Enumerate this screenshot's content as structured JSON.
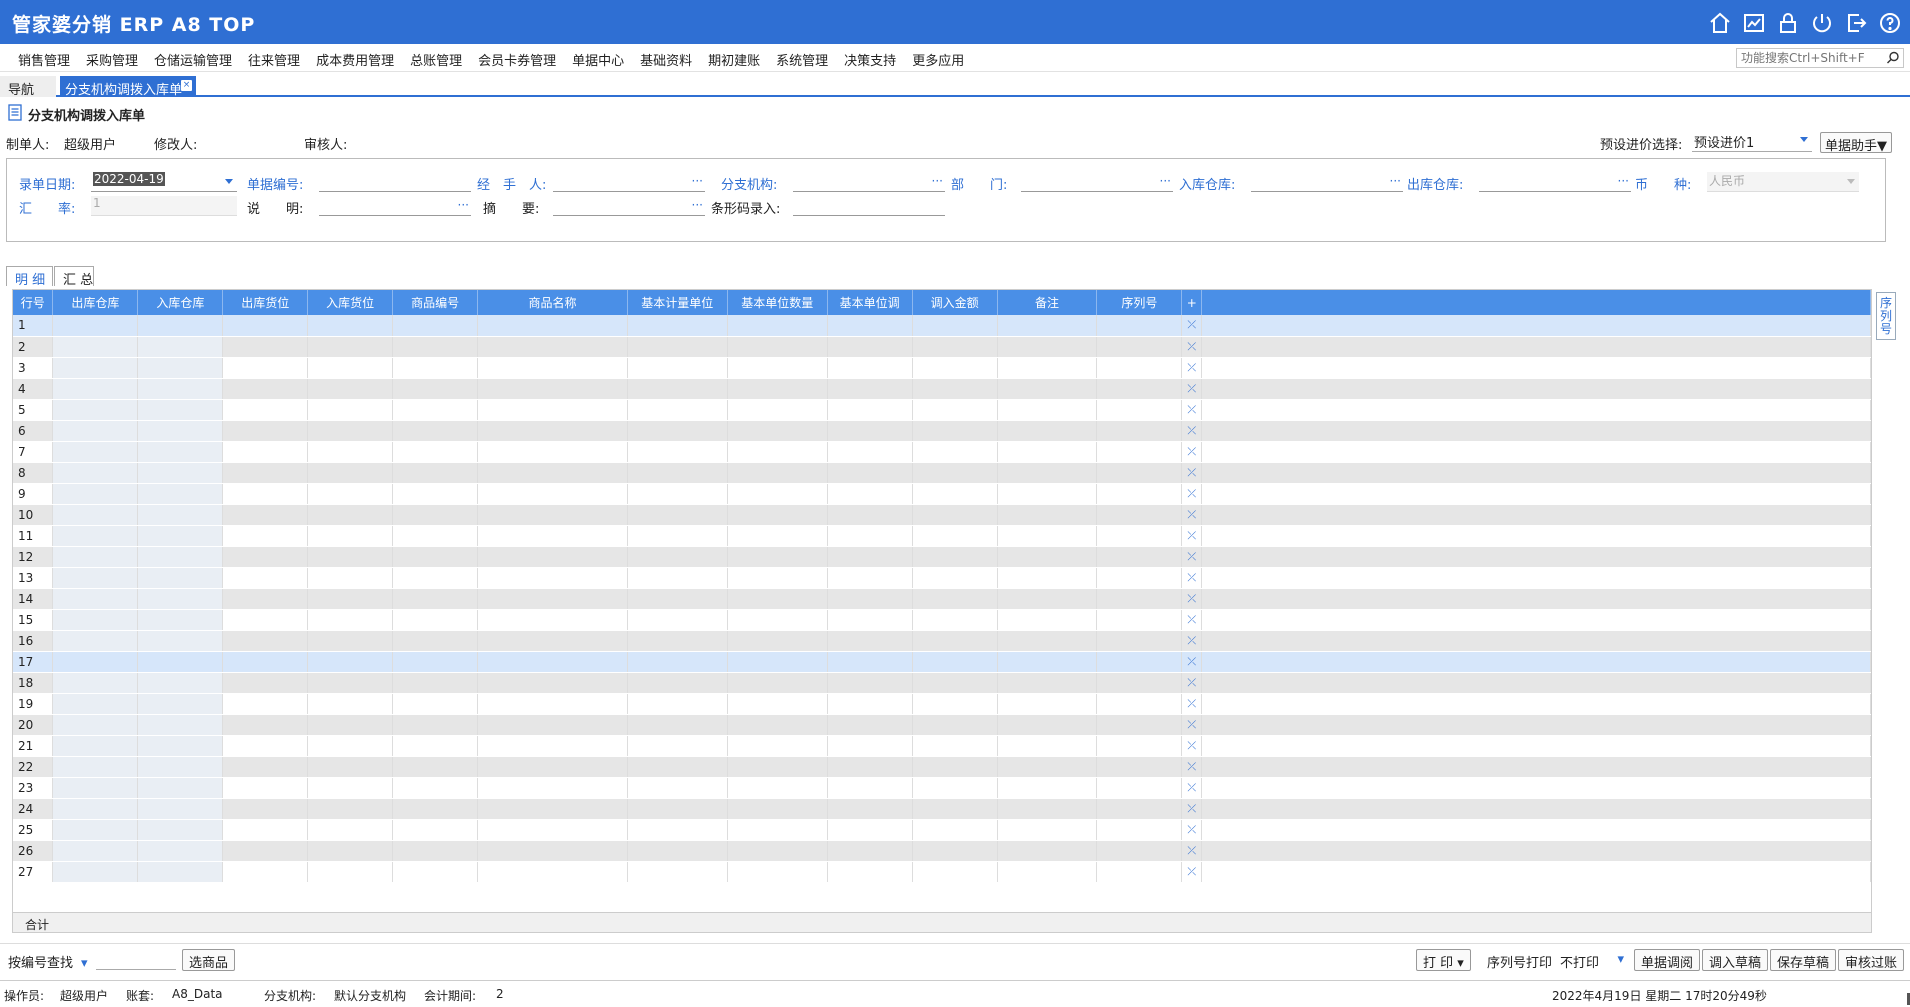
{
  "app": {
    "title": "管家婆分销 ERP A8 TOP"
  },
  "menu": [
    "销售管理",
    "采购管理",
    "仓储运输管理",
    "往来管理",
    "成本费用管理",
    "总账管理",
    "会员卡券管理",
    "单据中心",
    "基础资料",
    "期初建账",
    "系统管理",
    "决策支持",
    "更多应用"
  ],
  "search": {
    "placeholder": "功能搜索Ctrl+Shift+F"
  },
  "tabs": {
    "nav": "导航",
    "active": "分支机构调拨入库单",
    "close": "×"
  },
  "doc": {
    "title": "分支机构调拨入库单"
  },
  "creators": {
    "maker_label": "制单人:",
    "maker": "超级用户",
    "modifier_label": "修改人:",
    "auditor_label": "审核人:",
    "preset_label": "预设进价选择:",
    "preset_value": "预设进价1",
    "helper": "单据助手▼"
  },
  "form": {
    "date_label": "录单日期:",
    "date_value": "2022-04-19",
    "doc_no_label": "单据编号:",
    "handler_label": "经　手　人:",
    "branch_label": "分支机构:",
    "dept_label": "部　　门:",
    "in_wh_label": "入库仓库:",
    "out_wh_label": "出库仓库:",
    "currency_label": "币　　种:",
    "currency_value": "人民币",
    "rate_label": "汇　　率:",
    "rate_value": "1",
    "note_label": "说　　明:",
    "summary_label": "摘　　要:",
    "barcode_label": "条形码录入:",
    "dots": "···"
  },
  "subtabs": {
    "detail": "明 细",
    "summary": "汇 总"
  },
  "table": {
    "headers": [
      "行号",
      "出库仓库",
      "入库仓库",
      "出库货位",
      "入库货位",
      "商品编号",
      "商品名称",
      "基本计量单位",
      "基本单位数量",
      "基本单位调",
      "调入金额",
      "备注",
      "序列号",
      "+"
    ],
    "rows": [
      "1",
      "2",
      "3",
      "4",
      "5",
      "6",
      "7",
      "8",
      "9",
      "10",
      "11",
      "12",
      "13",
      "14",
      "15",
      "16",
      "17",
      "18",
      "19",
      "20",
      "21",
      "22",
      "23",
      "24",
      "25",
      "26",
      "27"
    ],
    "delete_icon": "⤫",
    "total_label": "合计"
  },
  "side_tab": "序列号",
  "bottom": {
    "search_mode": "按编号查找",
    "select_goods": "选商品",
    "print": "打 印 ▾",
    "serial_print_label": "序列号打印",
    "serial_print_value": "不打印",
    "btn_adjust": "单据调阅",
    "btn_load_draft": "调入草稿",
    "btn_save_draft": "保存草稿",
    "btn_audit": "审核过账"
  },
  "status": {
    "operator_label": "操作员:",
    "operator": "超级用户",
    "account_label": "账套:",
    "account": "A8_Data",
    "branch_label": "分支机构:",
    "branch": "默认分支机构",
    "period_label": "会计期间:",
    "period": "2",
    "datetime": "2022年4月19日 星期二 17时20分49秒"
  },
  "icons": [
    "home-icon",
    "chart-icon",
    "lock-icon",
    "power-icon",
    "logout-icon",
    "help-icon"
  ]
}
